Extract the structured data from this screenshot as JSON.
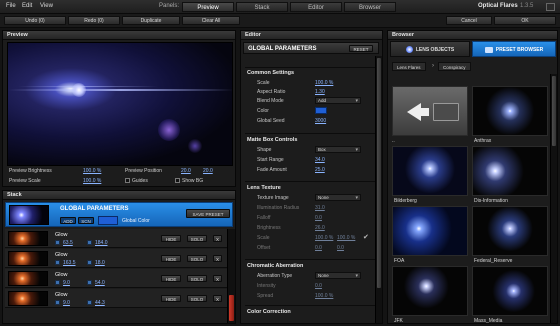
{
  "menu": {
    "items": [
      "File",
      "Edit",
      "View"
    ],
    "panels_label": "Panels:"
  },
  "panel_tabs": [
    "Preview",
    "Stack",
    "Editor",
    "Browser"
  ],
  "app": {
    "title": "Optical Flares",
    "version": "1.3.5"
  },
  "toolbar": {
    "undo": "Undo (0)",
    "redo": "Redo (0)",
    "duplicate": "Duplicate",
    "clear_all": "Clear All",
    "cancel": "Cancel",
    "ok": "OK"
  },
  "preview": {
    "header": "Preview",
    "brightness_label": "Preview Brightness",
    "brightness_value": "100.0 %",
    "position_label": "Preview Position",
    "position_x": "20.0",
    "position_y": "20.0",
    "scale_label": "Preview Scale",
    "scale_value": "100.0 %",
    "guides_label": "Guides",
    "show_bg_label": "Show BG"
  },
  "stack": {
    "header": "Stack",
    "global_label": "GLOBAL PARAMETERS",
    "add_label": "ADD",
    "scn_label": "SCN",
    "global_color_label": "Global Color",
    "save_preset": "SAVE PRESET",
    "rows": [
      {
        "name": "Glow",
        "v1": "63.5",
        "v2": "184.0",
        "hide": "HIDE",
        "solo": "SOLO",
        "x": "X"
      },
      {
        "name": "Glow",
        "v1": "163.5",
        "v2": "18.0",
        "hide": "HIDE",
        "solo": "SOLO",
        "x": "X"
      },
      {
        "name": "Glow",
        "v1": "9.0",
        "v2": "54.0",
        "hide": "HIDE",
        "solo": "SOLO",
        "x": "X"
      },
      {
        "name": "Glow",
        "v1": "9.0",
        "v2": "44.3",
        "hide": "HIDE",
        "solo": "SOLO",
        "x": "X"
      }
    ]
  },
  "editor": {
    "header": "Editor",
    "title": "GLOBAL PARAMETERS",
    "reset": "RESET",
    "common": {
      "title": "Common Settings",
      "scale_label": "Scale",
      "scale": "100.0 %",
      "aspect_label": "Aspect Ratio",
      "aspect": "1.30",
      "blend_label": "Blend Mode",
      "blend": "Add",
      "color_label": "Color",
      "seed_label": "Global Seed",
      "seed": "3000"
    },
    "matte": {
      "title": "Matte Box Controls",
      "shape_label": "Shape",
      "shape": "Box",
      "start_label": "Start Range",
      "start": "34.0",
      "fade_label": "Fade Amount",
      "fade": "25.0"
    },
    "lens": {
      "title": "Lens Texture",
      "image_label": "Texture Image",
      "image": "None",
      "illum_label": "Illumination Radius",
      "illum": "31.0",
      "falloff_label": "Falloff",
      "falloff": "0.0",
      "brightness_label": "Brightness",
      "brightness": "26.0",
      "scale_label": "Scale",
      "scale_a": "100.0 %",
      "scale_b": "100.0 %",
      "offset_label": "Offset",
      "offset_a": "0.0",
      "offset_b": "0.0"
    },
    "chrom": {
      "title": "Chromatic Aberration",
      "type_label": "Aberration Type",
      "type": "None",
      "intensity_label": "Intensity",
      "intensity": "0.0",
      "spread_label": "Spread",
      "spread": "100.0 %"
    },
    "color_corr": {
      "title": "Color Correction"
    }
  },
  "browser": {
    "header": "Browser",
    "tab_lens": "LENS OBJECTS",
    "tab_preset": "PRESET BROWSER",
    "crumb_root": "Lens Flares",
    "crumb_child": "Conspiracy",
    "items": [
      "..",
      "Anthrax",
      "Bilderberg",
      "Dis-Information",
      "FOA",
      "Federal_Reserve",
      "JFK",
      "Mass_Media"
    ]
  },
  "colors": {
    "accent_blue": "#1a7de0",
    "link_blue": "#8ab4ff",
    "panel_bg": "#1c1c1c"
  }
}
